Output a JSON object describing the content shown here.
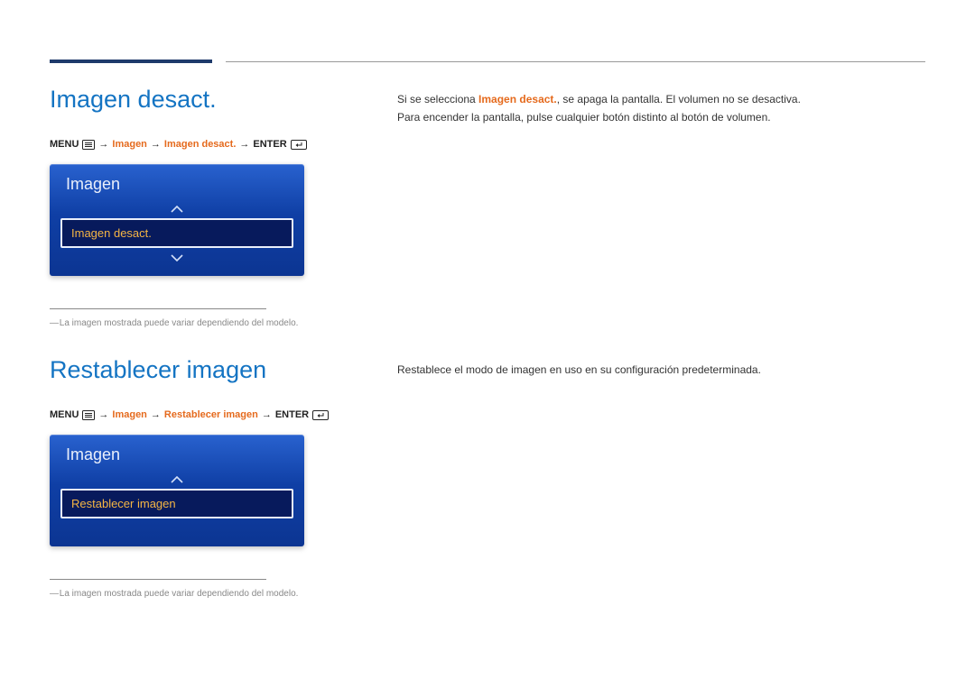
{
  "section1": {
    "title": "Imagen desact.",
    "path": {
      "menu": "MENU",
      "seg1": "Imagen",
      "seg2": "Imagen desact.",
      "enter": "ENTER"
    },
    "osd": {
      "title": "Imagen",
      "selected": "Imagen desact."
    },
    "footnote": "La imagen mostrada puede variar dependiendo del modelo.",
    "body_prefix": "Si se selecciona ",
    "body_highlight": "Imagen desact.",
    "body_suffix": ", se apaga la pantalla. El volumen no se desactiva.",
    "body_line2": "Para encender la pantalla, pulse cualquier botón distinto al botón de volumen."
  },
  "section2": {
    "title": "Restablecer imagen",
    "path": {
      "menu": "MENU",
      "seg1": "Imagen",
      "seg2": "Restablecer imagen",
      "enter": "ENTER"
    },
    "osd": {
      "title": "Imagen",
      "selected": "Restablecer imagen"
    },
    "footnote": "La imagen mostrada puede variar dependiendo del modelo.",
    "body": "Restablece el modo de imagen en uso en su configuración predeterminada."
  }
}
